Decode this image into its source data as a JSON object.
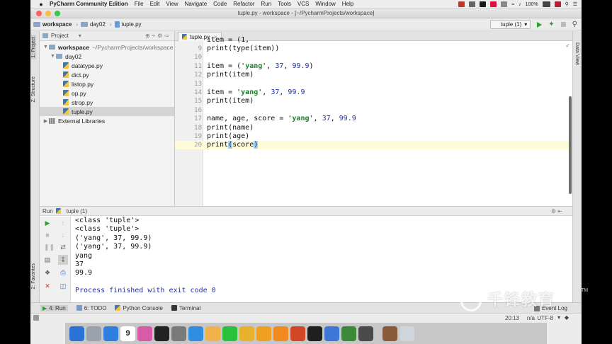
{
  "menubar": {
    "app_name": "PyCharm Community Edition",
    "items": [
      "File",
      "Edit",
      "View",
      "Navigate",
      "Code",
      "Refactor",
      "Run",
      "Tools",
      "VCS",
      "Window",
      "Help"
    ],
    "battery": "100%",
    "lang_icon": "us-flag-icon"
  },
  "window": {
    "title": "tuple.py - workspace - [~/PycharmProjects/workspace]"
  },
  "navbar": {
    "crumbs": [
      "workspace",
      "day02",
      "tuple.py"
    ],
    "run_config": "tuple (1)"
  },
  "side_tabs": {
    "project": "1: Project",
    "structure": "Z: Structure",
    "favorites": "2: Favorites",
    "data_view": "Data View"
  },
  "project": {
    "header": "Project",
    "root_name": "workspace",
    "root_path": "~/PycharmProjects/workspace",
    "folder": "day02",
    "files": [
      "datatype.py",
      "dict.py",
      "listop.py",
      "op.py",
      "strop.py",
      "tuple.py"
    ],
    "selected_file": "tuple.py",
    "external": "External Libraries"
  },
  "editor": {
    "tab_label": "tuple.py",
    "partial_top": "item = (1,",
    "lines": [
      {
        "n": "9",
        "tokens": [
          {
            "t": "print(type(item))",
            "c": ""
          }
        ]
      },
      {
        "n": "10",
        "tokens": []
      },
      {
        "n": "11",
        "tokens": [
          {
            "t": "item = (",
            "c": ""
          },
          {
            "t": "'yang'",
            "c": "str"
          },
          {
            "t": ", ",
            "c": ""
          },
          {
            "t": "37",
            "c": "num"
          },
          {
            "t": ", ",
            "c": ""
          },
          {
            "t": "99.9",
            "c": "num"
          },
          {
            "t": ")",
            "c": ""
          }
        ]
      },
      {
        "n": "12",
        "tokens": [
          {
            "t": "print(item)",
            "c": ""
          }
        ]
      },
      {
        "n": "13",
        "tokens": []
      },
      {
        "n": "14",
        "tokens": [
          {
            "t": "item = ",
            "c": ""
          },
          {
            "t": "'yang'",
            "c": "str"
          },
          {
            "t": ", ",
            "c": ""
          },
          {
            "t": "37",
            "c": "num"
          },
          {
            "t": ", ",
            "c": ""
          },
          {
            "t": "99.9",
            "c": "num"
          }
        ]
      },
      {
        "n": "15",
        "tokens": [
          {
            "t": "print(item)",
            "c": ""
          }
        ]
      },
      {
        "n": "16",
        "tokens": []
      },
      {
        "n": "17",
        "tokens": [
          {
            "t": "name, age, score = ",
            "c": ""
          },
          {
            "t": "'yang'",
            "c": "str"
          },
          {
            "t": ", ",
            "c": ""
          },
          {
            "t": "37",
            "c": "num"
          },
          {
            "t": ", ",
            "c": ""
          },
          {
            "t": "99.9",
            "c": "num"
          }
        ]
      },
      {
        "n": "18",
        "tokens": [
          {
            "t": "print(name)",
            "c": ""
          }
        ]
      },
      {
        "n": "19",
        "tokens": [
          {
            "t": "print(age)",
            "c": ""
          }
        ]
      },
      {
        "n": "20",
        "tokens": [
          {
            "t": "print",
            "c": ""
          },
          {
            "t": "(",
            "c": "hl"
          },
          {
            "t": "score",
            "c": ""
          },
          {
            "t": ")",
            "c": "hl"
          }
        ],
        "current": true
      }
    ]
  },
  "run_panel": {
    "label": "Run",
    "config": "tuple (1)",
    "output": [
      "<class 'tuple'>",
      "<class 'tuple'>",
      "('yang', 37, 99.9)",
      "('yang', 37, 99.9)",
      "yang",
      "37",
      "99.9"
    ],
    "exit_message": "Process finished with exit code 0"
  },
  "bottom_tabs": [
    "4: Run",
    "6: TODO",
    "Python Console",
    "Terminal"
  ],
  "status": {
    "position": "20:13",
    "line_sep": "n/a",
    "encoding": "UTF-8",
    "event_log": "Event Log"
  },
  "watermark": {
    "text": "千锋教育",
    "tm": "TM"
  },
  "dock": {
    "calendar_day": "9",
    "icons": [
      "finder-icon",
      "launchpad-icon",
      "safari-icon",
      "calendar-icon",
      "itunes-icon",
      "terminal-icon",
      "system-preferences-icon",
      "xcode-icon",
      "photos-icon",
      "wechat-icon",
      "weibo-icon",
      "qq-icon",
      "sublime-icon",
      "powerpoint-icon",
      "pycharm-icon",
      "baidu-icon",
      "chrome-icon",
      "notes-icon",
      "finder2-icon",
      "trash-icon"
    ],
    "colors": [
      "#2a72d8",
      "#9aa2ad",
      "#2f7fe0",
      "#ffffff",
      "#d85aa8",
      "#222222",
      "#7a7a7a",
      "#2f8ee0",
      "#f2b24a",
      "#2ac13b",
      "#e8b32a",
      "#f0a020",
      "#f28a1f",
      "#d24726",
      "#1f1f1f",
      "#3d78d8",
      "#3a8a3a",
      "#4a4a4a",
      "#8a5a3a",
      "#cfd5dc"
    ]
  }
}
